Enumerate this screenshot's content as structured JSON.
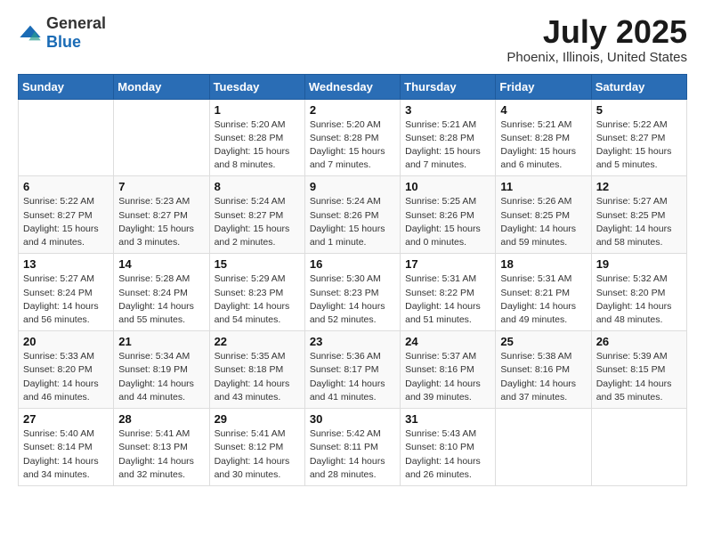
{
  "logo": {
    "text_general": "General",
    "text_blue": "Blue"
  },
  "title": {
    "month_year": "July 2025",
    "location": "Phoenix, Illinois, United States"
  },
  "weekdays": [
    "Sunday",
    "Monday",
    "Tuesday",
    "Wednesday",
    "Thursday",
    "Friday",
    "Saturday"
  ],
  "weeks": [
    [
      {
        "day": "",
        "info": ""
      },
      {
        "day": "",
        "info": ""
      },
      {
        "day": "1",
        "info": "Sunrise: 5:20 AM\nSunset: 8:28 PM\nDaylight: 15 hours\nand 8 minutes."
      },
      {
        "day": "2",
        "info": "Sunrise: 5:20 AM\nSunset: 8:28 PM\nDaylight: 15 hours\nand 7 minutes."
      },
      {
        "day": "3",
        "info": "Sunrise: 5:21 AM\nSunset: 8:28 PM\nDaylight: 15 hours\nand 7 minutes."
      },
      {
        "day": "4",
        "info": "Sunrise: 5:21 AM\nSunset: 8:28 PM\nDaylight: 15 hours\nand 6 minutes."
      },
      {
        "day": "5",
        "info": "Sunrise: 5:22 AM\nSunset: 8:27 PM\nDaylight: 15 hours\nand 5 minutes."
      }
    ],
    [
      {
        "day": "6",
        "info": "Sunrise: 5:22 AM\nSunset: 8:27 PM\nDaylight: 15 hours\nand 4 minutes."
      },
      {
        "day": "7",
        "info": "Sunrise: 5:23 AM\nSunset: 8:27 PM\nDaylight: 15 hours\nand 3 minutes."
      },
      {
        "day": "8",
        "info": "Sunrise: 5:24 AM\nSunset: 8:27 PM\nDaylight: 15 hours\nand 2 minutes."
      },
      {
        "day": "9",
        "info": "Sunrise: 5:24 AM\nSunset: 8:26 PM\nDaylight: 15 hours\nand 1 minute."
      },
      {
        "day": "10",
        "info": "Sunrise: 5:25 AM\nSunset: 8:26 PM\nDaylight: 15 hours\nand 0 minutes."
      },
      {
        "day": "11",
        "info": "Sunrise: 5:26 AM\nSunset: 8:25 PM\nDaylight: 14 hours\nand 59 minutes."
      },
      {
        "day": "12",
        "info": "Sunrise: 5:27 AM\nSunset: 8:25 PM\nDaylight: 14 hours\nand 58 minutes."
      }
    ],
    [
      {
        "day": "13",
        "info": "Sunrise: 5:27 AM\nSunset: 8:24 PM\nDaylight: 14 hours\nand 56 minutes."
      },
      {
        "day": "14",
        "info": "Sunrise: 5:28 AM\nSunset: 8:24 PM\nDaylight: 14 hours\nand 55 minutes."
      },
      {
        "day": "15",
        "info": "Sunrise: 5:29 AM\nSunset: 8:23 PM\nDaylight: 14 hours\nand 54 minutes."
      },
      {
        "day": "16",
        "info": "Sunrise: 5:30 AM\nSunset: 8:23 PM\nDaylight: 14 hours\nand 52 minutes."
      },
      {
        "day": "17",
        "info": "Sunrise: 5:31 AM\nSunset: 8:22 PM\nDaylight: 14 hours\nand 51 minutes."
      },
      {
        "day": "18",
        "info": "Sunrise: 5:31 AM\nSunset: 8:21 PM\nDaylight: 14 hours\nand 49 minutes."
      },
      {
        "day": "19",
        "info": "Sunrise: 5:32 AM\nSunset: 8:20 PM\nDaylight: 14 hours\nand 48 minutes."
      }
    ],
    [
      {
        "day": "20",
        "info": "Sunrise: 5:33 AM\nSunset: 8:20 PM\nDaylight: 14 hours\nand 46 minutes."
      },
      {
        "day": "21",
        "info": "Sunrise: 5:34 AM\nSunset: 8:19 PM\nDaylight: 14 hours\nand 44 minutes."
      },
      {
        "day": "22",
        "info": "Sunrise: 5:35 AM\nSunset: 8:18 PM\nDaylight: 14 hours\nand 43 minutes."
      },
      {
        "day": "23",
        "info": "Sunrise: 5:36 AM\nSunset: 8:17 PM\nDaylight: 14 hours\nand 41 minutes."
      },
      {
        "day": "24",
        "info": "Sunrise: 5:37 AM\nSunset: 8:16 PM\nDaylight: 14 hours\nand 39 minutes."
      },
      {
        "day": "25",
        "info": "Sunrise: 5:38 AM\nSunset: 8:16 PM\nDaylight: 14 hours\nand 37 minutes."
      },
      {
        "day": "26",
        "info": "Sunrise: 5:39 AM\nSunset: 8:15 PM\nDaylight: 14 hours\nand 35 minutes."
      }
    ],
    [
      {
        "day": "27",
        "info": "Sunrise: 5:40 AM\nSunset: 8:14 PM\nDaylight: 14 hours\nand 34 minutes."
      },
      {
        "day": "28",
        "info": "Sunrise: 5:41 AM\nSunset: 8:13 PM\nDaylight: 14 hours\nand 32 minutes."
      },
      {
        "day": "29",
        "info": "Sunrise: 5:41 AM\nSunset: 8:12 PM\nDaylight: 14 hours\nand 30 minutes."
      },
      {
        "day": "30",
        "info": "Sunrise: 5:42 AM\nSunset: 8:11 PM\nDaylight: 14 hours\nand 28 minutes."
      },
      {
        "day": "31",
        "info": "Sunrise: 5:43 AM\nSunset: 8:10 PM\nDaylight: 14 hours\nand 26 minutes."
      },
      {
        "day": "",
        "info": ""
      },
      {
        "day": "",
        "info": ""
      }
    ]
  ]
}
